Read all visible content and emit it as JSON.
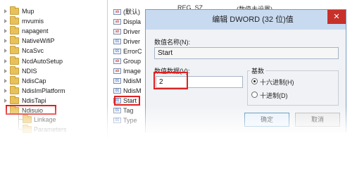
{
  "tree": {
    "items": [
      {
        "label": "Mup"
      },
      {
        "label": "mvumis"
      },
      {
        "label": "napagent"
      },
      {
        "label": "NativeWifiP"
      },
      {
        "label": "NcaSvc"
      },
      {
        "label": "NcdAutoSetup"
      },
      {
        "label": "NDIS"
      },
      {
        "label": "NdisCap"
      },
      {
        "label": "NdisImPlatform"
      },
      {
        "label": "NdisTapi"
      },
      {
        "label": "Ndisuio"
      },
      {
        "label": "Linkage"
      },
      {
        "label": "Parameters"
      }
    ]
  },
  "values": {
    "header_type": "REG_SZ",
    "header_data": "(数值未设置)",
    "rows": [
      {
        "label": "(默认)",
        "kind": "string"
      },
      {
        "label": "Displa",
        "kind": "string"
      },
      {
        "label": "Driver",
        "kind": "string"
      },
      {
        "label": "Driver",
        "kind": "binary"
      },
      {
        "label": "ErrorC",
        "kind": "binary"
      },
      {
        "label": "Group",
        "kind": "string"
      },
      {
        "label": "Image",
        "kind": "string"
      },
      {
        "label": "NdisM",
        "kind": "binary"
      },
      {
        "label": "NdisM",
        "kind": "binary"
      },
      {
        "label": "Start",
        "kind": "binary"
      },
      {
        "label": "Tag",
        "kind": "binary"
      },
      {
        "label": "Type",
        "kind": "binary"
      }
    ]
  },
  "dialog": {
    "title": "编辑 DWORD (32 位)值",
    "close": "✕",
    "name_label": "数值名称(N):",
    "name_value": "Start",
    "data_label": "数值数据(V):",
    "data_value": "2",
    "base_label": "基数",
    "radio_hex": "十六进制(H)",
    "radio_dec": "十进制(D)",
    "selected_base": "hex",
    "ok_label": "确定",
    "cancel_label": "取消"
  },
  "colors": {
    "highlight": "#e02020",
    "titlebar": "#c8daf0",
    "close": "#c8302a",
    "folder": "#e8c15a"
  }
}
